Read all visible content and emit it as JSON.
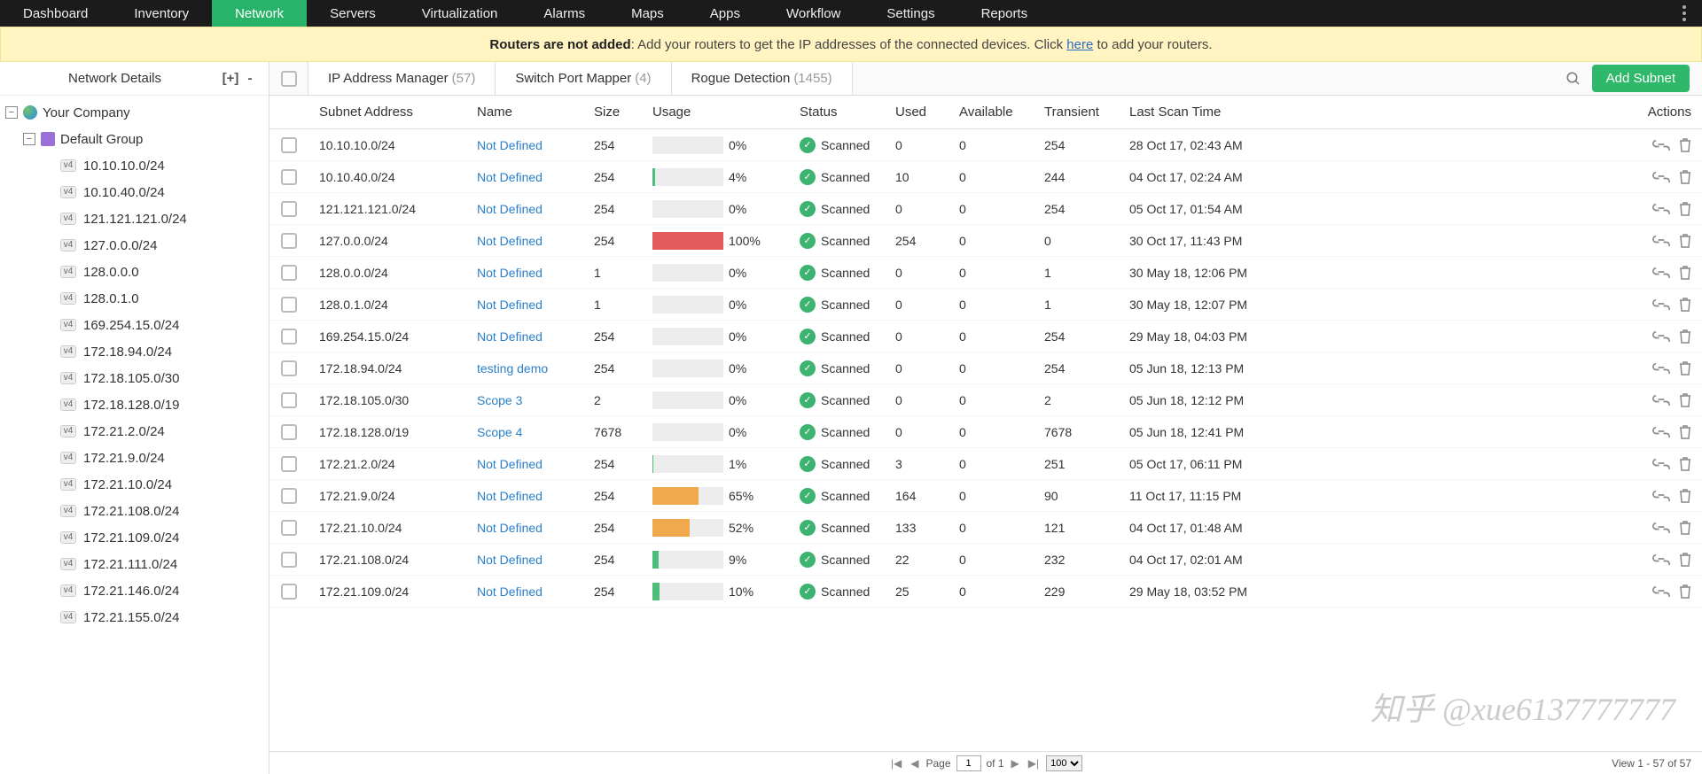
{
  "nav": [
    "Dashboard",
    "Inventory",
    "Network",
    "Servers",
    "Virtualization",
    "Alarms",
    "Maps",
    "Apps",
    "Workflow",
    "Settings",
    "Reports"
  ],
  "nav_active": 2,
  "banner": {
    "b": "Routers are not added",
    "t1": ": Add your routers to get the IP addresses of the connected devices. Click ",
    "link": "here",
    "t2": " to add your routers."
  },
  "sidebar": {
    "title": "Network Details",
    "root": "Your Company",
    "group": "Default Group",
    "items": [
      "10.10.10.0/24",
      "10.10.40.0/24",
      "121.121.121.0/24",
      "127.0.0.0/24",
      "128.0.0.0",
      "128.0.1.0",
      "169.254.15.0/24",
      "172.18.94.0/24",
      "172.18.105.0/30",
      "172.18.128.0/19",
      "172.21.2.0/24",
      "172.21.9.0/24",
      "172.21.10.0/24",
      "172.21.108.0/24",
      "172.21.109.0/24",
      "172.21.111.0/24",
      "172.21.146.0/24",
      "172.21.155.0/24"
    ]
  },
  "tabs": [
    {
      "l": "IP Address Manager",
      "c": "(57)"
    },
    {
      "l": "Switch Port Mapper",
      "c": "(4)"
    },
    {
      "l": "Rogue Detection",
      "c": "(1455)"
    }
  ],
  "add_btn": "Add Subnet",
  "cols": [
    "Subnet Address",
    "Name",
    "Size",
    "Usage",
    "Status",
    "Used",
    "Available",
    "Transient",
    "Last Scan Time",
    "Actions"
  ],
  "rows": [
    {
      "sub": "10.10.10.0/24",
      "name": "Not Defined",
      "sz": "254",
      "pct": 0,
      "col": "grn",
      "st": "Scanned",
      "u": "0",
      "a": "0",
      "t": "254",
      "scan": "28 Oct 17, 02:43 AM"
    },
    {
      "sub": "10.10.40.0/24",
      "name": "Not Defined",
      "sz": "254",
      "pct": 4,
      "col": "grn",
      "st": "Scanned",
      "u": "10",
      "a": "0",
      "t": "244",
      "scan": "04 Oct 17, 02:24 AM"
    },
    {
      "sub": "121.121.121.0/24",
      "name": "Not Defined",
      "sz": "254",
      "pct": 0,
      "col": "grn",
      "st": "Scanned",
      "u": "0",
      "a": "0",
      "t": "254",
      "scan": "05 Oct 17, 01:54 AM"
    },
    {
      "sub": "127.0.0.0/24",
      "name": "Not Defined",
      "sz": "254",
      "pct": 100,
      "col": "red",
      "st": "Scanned",
      "u": "254",
      "a": "0",
      "t": "0",
      "scan": "30 Oct 17, 11:43 PM"
    },
    {
      "sub": "128.0.0.0/24",
      "name": "Not Defined",
      "sz": "1",
      "pct": 0,
      "col": "grn",
      "st": "Scanned",
      "u": "0",
      "a": "0",
      "t": "1",
      "scan": "30 May 18, 12:06 PM"
    },
    {
      "sub": "128.0.1.0/24",
      "name": "Not Defined",
      "sz": "1",
      "pct": 0,
      "col": "grn",
      "st": "Scanned",
      "u": "0",
      "a": "0",
      "t": "1",
      "scan": "30 May 18, 12:07 PM"
    },
    {
      "sub": "169.254.15.0/24",
      "name": "Not Defined",
      "sz": "254",
      "pct": 0,
      "col": "grn",
      "st": "Scanned",
      "u": "0",
      "a": "0",
      "t": "254",
      "scan": "29 May 18, 04:03 PM"
    },
    {
      "sub": "172.18.94.0/24",
      "name": "testing demo",
      "sz": "254",
      "pct": 0,
      "col": "grn",
      "st": "Scanned",
      "u": "0",
      "a": "0",
      "t": "254",
      "scan": "05 Jun 18, 12:13 PM"
    },
    {
      "sub": "172.18.105.0/30",
      "name": "Scope 3",
      "sz": "2",
      "pct": 0,
      "col": "grn",
      "st": "Scanned",
      "u": "0",
      "a": "0",
      "t": "2",
      "scan": "05 Jun 18, 12:12 PM"
    },
    {
      "sub": "172.18.128.0/19",
      "name": "Scope 4",
      "sz": "7678",
      "pct": 0,
      "col": "grn",
      "st": "Scanned",
      "u": "0",
      "a": "0",
      "t": "7678",
      "scan": "05 Jun 18, 12:41 PM"
    },
    {
      "sub": "172.21.2.0/24",
      "name": "Not Defined",
      "sz": "254",
      "pct": 1,
      "col": "grn",
      "st": "Scanned",
      "u": "3",
      "a": "0",
      "t": "251",
      "scan": "05 Oct 17, 06:11 PM"
    },
    {
      "sub": "172.21.9.0/24",
      "name": "Not Defined",
      "sz": "254",
      "pct": 65,
      "col": "org",
      "st": "Scanned",
      "u": "164",
      "a": "0",
      "t": "90",
      "scan": "11 Oct 17, 11:15 PM"
    },
    {
      "sub": "172.21.10.0/24",
      "name": "Not Defined",
      "sz": "254",
      "pct": 52,
      "col": "org",
      "st": "Scanned",
      "u": "133",
      "a": "0",
      "t": "121",
      "scan": "04 Oct 17, 01:48 AM"
    },
    {
      "sub": "172.21.108.0/24",
      "name": "Not Defined",
      "sz": "254",
      "pct": 9,
      "col": "grn",
      "st": "Scanned",
      "u": "22",
      "a": "0",
      "t": "232",
      "scan": "04 Oct 17, 02:01 AM"
    },
    {
      "sub": "172.21.109.0/24",
      "name": "Not Defined",
      "sz": "254",
      "pct": 10,
      "col": "grn",
      "st": "Scanned",
      "u": "25",
      "a": "0",
      "t": "229",
      "scan": "29 May 18, 03:52 PM"
    }
  ],
  "pager": {
    "page": "1",
    "of": "of 1",
    "per": "100",
    "view": "View 1 - 57 of 57",
    "lbl": "Page"
  },
  "wm": "知乎 @xue6137777777"
}
